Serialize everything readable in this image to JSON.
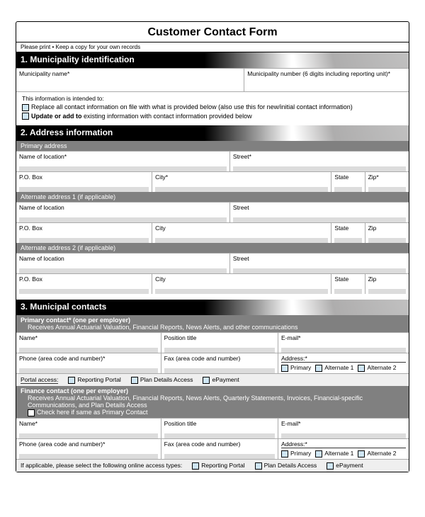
{
  "title": "Customer Contact Form",
  "note": "Please print • Keep a copy for your own records",
  "s1": {
    "head": "1. Municipality identification",
    "muni_name": "Municipality name*",
    "muni_num": "Municipality number (6 digits including reporting unit)*",
    "intended": "This information is intended to:",
    "opt_replace": "Replace all contact information on file with what is provided below (also use this for new/initial contact information)",
    "opt_update_a": "Update or add to",
    "opt_update_b": " existing information with contact information provided below"
  },
  "s2": {
    "head": "2. Address information",
    "primary": "Primary address",
    "alt1": "Alternate address 1 (if applicable)",
    "alt2": "Alternate address 2 (if applicable)",
    "loc_req": "Name of location*",
    "loc": "Name of location",
    "street_req": "Street*",
    "street": "Street",
    "po": "P.O. Box",
    "city_req": "City*",
    "city": "City",
    "state": "State",
    "zip_req": "Zip*",
    "zip": "Zip"
  },
  "s3": {
    "head": "3. Municipal contacts",
    "primary_contact": "Primary contact* (one per employer)",
    "primary_desc": "Receives Annual Actuarial Valuation, Financial Reports, News Alerts, and other communications",
    "name": "Name*",
    "position": "Position title",
    "email": "E-mail*",
    "phone": "Phone (area code and number)*",
    "fax": "Fax (area code and number)",
    "address": "Address:*",
    "addr_primary": "Primary",
    "addr_alt1": "Alternate 1",
    "addr_alt2": "Alternate 2",
    "portal_access": "Portal access:",
    "reporting_portal": "Reporting Portal",
    "plan_details": "Plan Details Access",
    "epayment": "ePayment",
    "finance_contact": "Finance contact (one per employer)",
    "finance_desc": "Receives Annual Actuarial Valuation, Financial Reports, News Alerts, Quarterly Statements, Invoices, Financial-specific Communications, and Plan Details Access",
    "same_as": "Check here if same as Primary Contact",
    "online_access": "If applicable, please select the following online access types:"
  }
}
